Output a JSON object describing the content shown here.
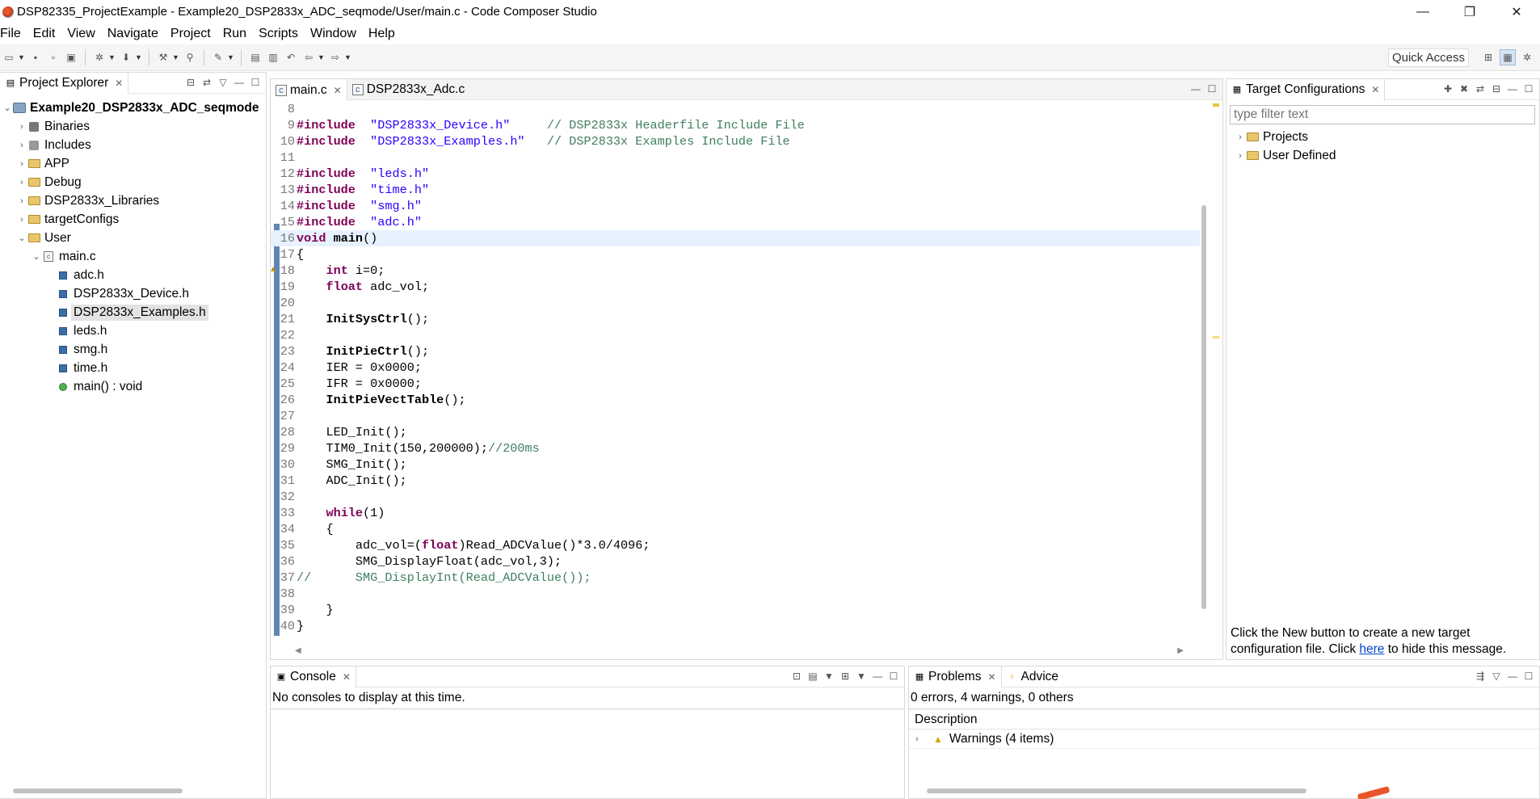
{
  "window": {
    "title": "DSP82335_ProjectExample - Example20_DSP2833x_ADC_seqmode/User/main.c - Code Composer Studio",
    "minimize": "—",
    "maximize": "❐",
    "close": "✕"
  },
  "menu": [
    "File",
    "Edit",
    "View",
    "Navigate",
    "Project",
    "Run",
    "Scripts",
    "Window",
    "Help"
  ],
  "toolbar": {
    "quick_access": "Quick Access"
  },
  "project_explorer": {
    "tab_label": "Project Explorer",
    "tree": [
      {
        "label": "Example20_DSP2833x_ADC_seqmode",
        "level": 0,
        "toggle": "⌄",
        "icon": "project-icon",
        "bold": true
      },
      {
        "label": "Binaries",
        "level": 1,
        "toggle": "›",
        "icon": "binaries-icon"
      },
      {
        "label": "Includes",
        "level": 1,
        "toggle": "›",
        "icon": "includes-icon"
      },
      {
        "label": "APP",
        "level": 1,
        "toggle": "›",
        "icon": "folder-icon"
      },
      {
        "label": "Debug",
        "level": 1,
        "toggle": "›",
        "icon": "folder-icon"
      },
      {
        "label": "DSP2833x_Libraries",
        "level": 1,
        "toggle": "›",
        "icon": "folder-icon"
      },
      {
        "label": "targetConfigs",
        "level": 1,
        "toggle": "›",
        "icon": "folder-icon"
      },
      {
        "label": "User",
        "level": 1,
        "toggle": "⌄",
        "icon": "folder-icon"
      },
      {
        "label": "main.c",
        "level": 2,
        "toggle": "⌄",
        "icon": "c-file-icon"
      },
      {
        "label": "adc.h",
        "level": 3,
        "toggle": "",
        "icon": "header-file-icon"
      },
      {
        "label": "DSP2833x_Device.h",
        "level": 3,
        "toggle": "",
        "icon": "header-file-icon"
      },
      {
        "label": "DSP2833x_Examples.h",
        "level": 3,
        "toggle": "",
        "icon": "header-file-icon",
        "selected": true
      },
      {
        "label": "leds.h",
        "level": 3,
        "toggle": "",
        "icon": "header-file-icon"
      },
      {
        "label": "smg.h",
        "level": 3,
        "toggle": "",
        "icon": "header-file-icon"
      },
      {
        "label": "time.h",
        "level": 3,
        "toggle": "",
        "icon": "header-file-icon"
      },
      {
        "label": "main() : void",
        "level": 3,
        "toggle": "",
        "icon": "function-icon"
      }
    ]
  },
  "editor": {
    "tabs": [
      {
        "label": "main.c",
        "active": true
      },
      {
        "label": "DSP2833x_Adc.c",
        "active": false
      }
    ],
    "current_line": 16,
    "warning_line": 18,
    "lines": [
      {
        "n": "8",
        "segs": []
      },
      {
        "n": "9",
        "segs": [
          [
            "kw",
            "#include"
          ],
          [
            "",
            "  "
          ],
          [
            "str",
            "\"DSP2833x_Device.h\""
          ],
          [
            "",
            "     "
          ],
          [
            "cmt",
            "// DSP2833x Headerfile Include File"
          ]
        ]
      },
      {
        "n": "10",
        "segs": [
          [
            "kw",
            "#include"
          ],
          [
            "",
            "  "
          ],
          [
            "str",
            "\"DSP2833x_Examples.h\""
          ],
          [
            "",
            "   "
          ],
          [
            "cmt",
            "// DSP2833x Examples Include File"
          ]
        ]
      },
      {
        "n": "11",
        "segs": []
      },
      {
        "n": "12",
        "segs": [
          [
            "kw",
            "#include"
          ],
          [
            "",
            "  "
          ],
          [
            "str",
            "\"leds.h\""
          ]
        ]
      },
      {
        "n": "13",
        "segs": [
          [
            "kw",
            "#include"
          ],
          [
            "",
            "  "
          ],
          [
            "str",
            "\"time.h\""
          ]
        ]
      },
      {
        "n": "14",
        "segs": [
          [
            "kw",
            "#include"
          ],
          [
            "",
            "  "
          ],
          [
            "str",
            "\"smg.h\""
          ]
        ]
      },
      {
        "n": "15",
        "segs": [
          [
            "kw",
            "#include"
          ],
          [
            "",
            "  "
          ],
          [
            "str",
            "\"adc.h\""
          ]
        ]
      },
      {
        "n": "16",
        "segs": [
          [
            "kw",
            "void"
          ],
          [
            "",
            " "
          ],
          [
            "fn",
            "main"
          ],
          [
            "",
            "()"
          ]
        ]
      },
      {
        "n": "17",
        "segs": [
          [
            "",
            "{"
          ]
        ]
      },
      {
        "n": "18",
        "segs": [
          [
            "",
            "    "
          ],
          [
            "kw",
            "int"
          ],
          [
            "",
            " i=0;"
          ]
        ]
      },
      {
        "n": "19",
        "segs": [
          [
            "",
            "    "
          ],
          [
            "kw",
            "float"
          ],
          [
            "",
            " adc_vol;"
          ]
        ]
      },
      {
        "n": "20",
        "segs": []
      },
      {
        "n": "21",
        "segs": [
          [
            "",
            "    "
          ],
          [
            "fn",
            "InitSysCtrl"
          ],
          [
            "",
            "();"
          ]
        ]
      },
      {
        "n": "22",
        "segs": []
      },
      {
        "n": "23",
        "segs": [
          [
            "",
            "    "
          ],
          [
            "fn",
            "InitPieCtrl"
          ],
          [
            "",
            "();"
          ]
        ]
      },
      {
        "n": "24",
        "segs": [
          [
            "",
            "    IER = 0x0000;"
          ]
        ]
      },
      {
        "n": "25",
        "segs": [
          [
            "",
            "    IFR = 0x0000;"
          ]
        ]
      },
      {
        "n": "26",
        "segs": [
          [
            "",
            "    "
          ],
          [
            "fn",
            "InitPieVectTable"
          ],
          [
            "",
            "();"
          ]
        ]
      },
      {
        "n": "27",
        "segs": []
      },
      {
        "n": "28",
        "segs": [
          [
            "",
            "    LED_Init();"
          ]
        ]
      },
      {
        "n": "29",
        "segs": [
          [
            "",
            "    TIM0_Init(150,200000);"
          ],
          [
            "cmt",
            "//200ms"
          ]
        ]
      },
      {
        "n": "30",
        "segs": [
          [
            "",
            "    SMG_Init();"
          ]
        ]
      },
      {
        "n": "31",
        "segs": [
          [
            "",
            "    ADC_Init();"
          ]
        ]
      },
      {
        "n": "32",
        "segs": []
      },
      {
        "n": "33",
        "segs": [
          [
            "",
            "    "
          ],
          [
            "kw",
            "while"
          ],
          [
            "",
            "(1)"
          ]
        ]
      },
      {
        "n": "34",
        "segs": [
          [
            "",
            "    {"
          ]
        ]
      },
      {
        "n": "35",
        "segs": [
          [
            "",
            "        adc_vol=("
          ],
          [
            "kw",
            "float"
          ],
          [
            "",
            ")Read_ADCValue()*3.0/4096;"
          ]
        ]
      },
      {
        "n": "36",
        "segs": [
          [
            "",
            "        SMG_DisplayFloat(adc_vol,3);"
          ]
        ]
      },
      {
        "n": "37",
        "segs": [
          [
            "cmt",
            "//      SMG_DisplayInt(Read_ADCValue());"
          ]
        ]
      },
      {
        "n": "38",
        "segs": []
      },
      {
        "n": "39",
        "segs": [
          [
            "",
            "    }"
          ]
        ]
      },
      {
        "n": "40",
        "segs": [
          [
            "",
            "}"
          ]
        ]
      }
    ]
  },
  "target_config": {
    "tab_label": "Target Configurations",
    "filter_placeholder": "type filter text",
    "tree": [
      "Projects",
      "User Defined"
    ],
    "msg_before": "Click the New button to create a new target configuration file. Click ",
    "msg_link": "here",
    "msg_after": " to hide this message."
  },
  "console": {
    "tab_label": "Console",
    "message": "No consoles to display at this time."
  },
  "problems": {
    "tab_label": "Problems",
    "advice_label": "Advice",
    "summary": "0 errors, 4 warnings, 0 others",
    "column": "Description",
    "rows": [
      {
        "label": "Warnings (4 items)"
      }
    ]
  }
}
